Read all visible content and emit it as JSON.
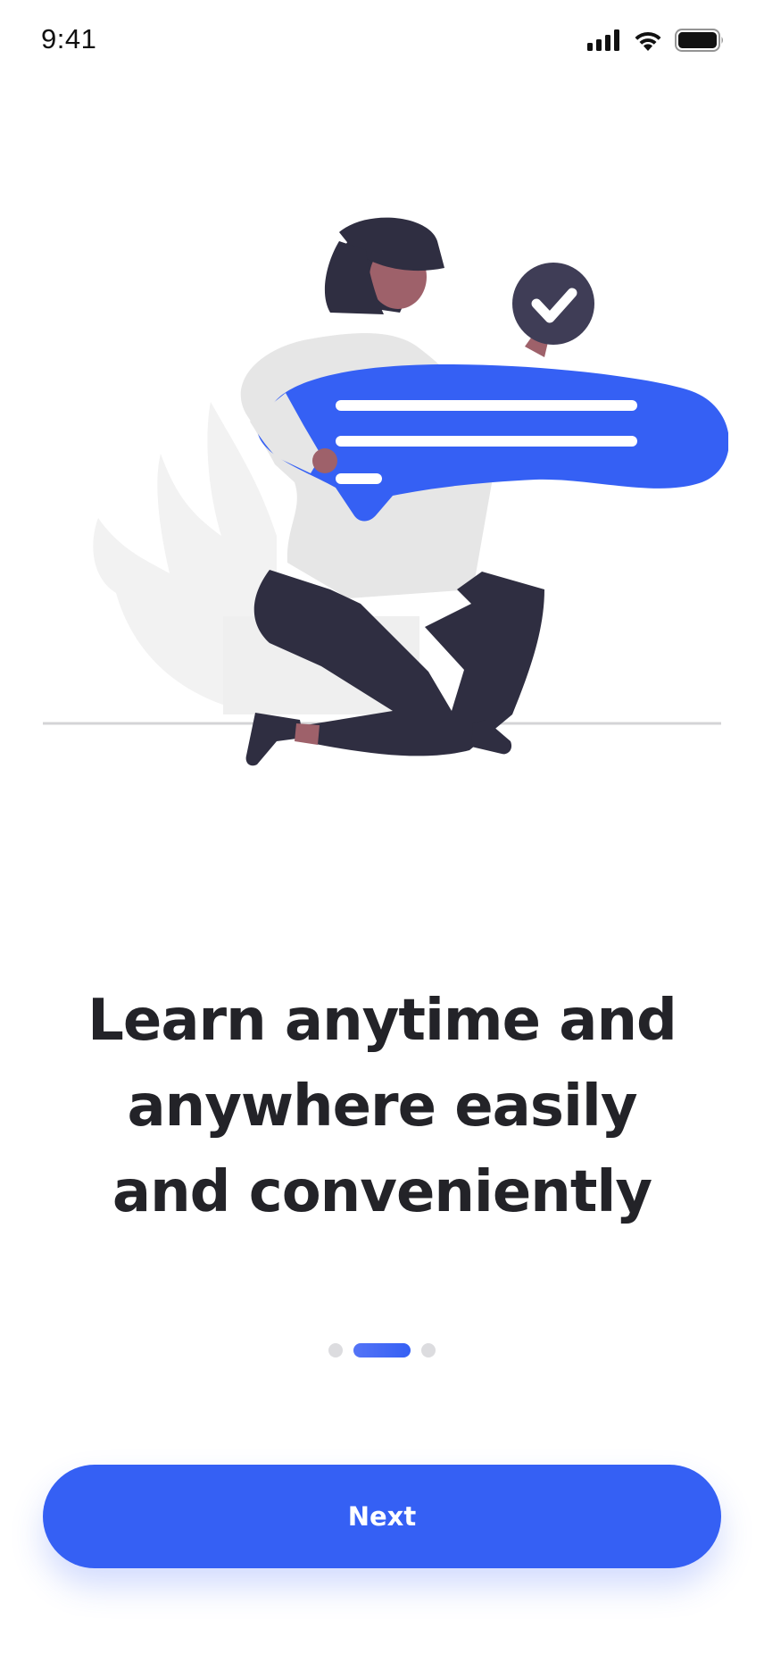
{
  "status_bar": {
    "time": "9:41",
    "icons": [
      "cellular-signal-icon",
      "wifi-icon",
      "battery-icon"
    ]
  },
  "illustration": {
    "name": "person-holding-chat-bubble-illustration",
    "colors": {
      "accent": "#3560f4",
      "dark": "#2f2e41",
      "skin": "#9e616a",
      "shirt": "#e6e6e6",
      "plant": "#f2f2f2"
    }
  },
  "onboarding": {
    "headline": "Learn anytime and\nanywhere easily\nand conveniently",
    "pager": {
      "count": 3,
      "active_index": 1
    }
  },
  "actions": {
    "next_label": "Next"
  },
  "theme": {
    "primary": "#3560f4",
    "text": "#232328",
    "inactive_dot": "#dcdcdf"
  }
}
